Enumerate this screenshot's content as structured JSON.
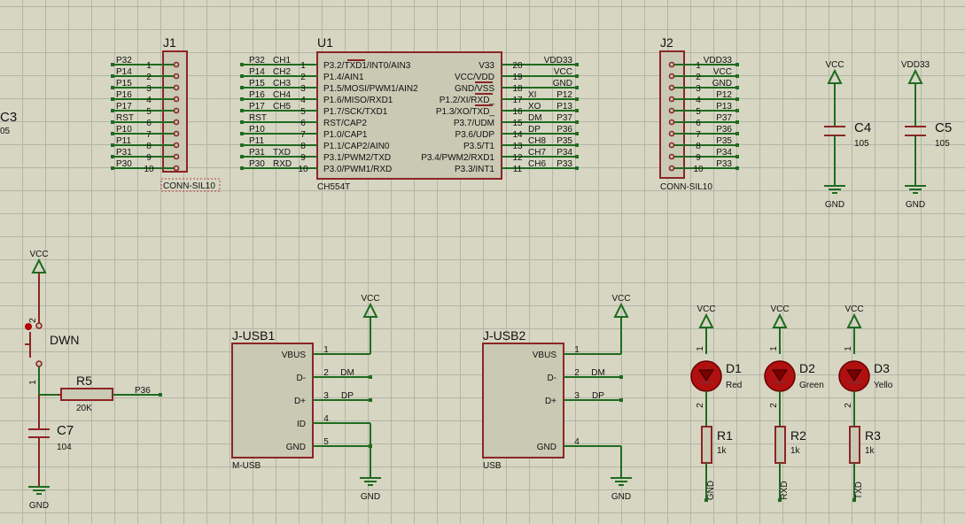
{
  "colors": {
    "background": "#d6d6c3",
    "grid": "#b5b5a6",
    "wire": "#1f6b1f",
    "component": "#8c2525",
    "body": "#c9c9b4",
    "text": "#111111"
  },
  "j1": {
    "ref": "J1",
    "type": "CONN-SIL10",
    "pins": [
      "1",
      "2",
      "3",
      "4",
      "5",
      "6",
      "7",
      "8",
      "9",
      "10"
    ],
    "nets": [
      "P32",
      "P14",
      "P15",
      "P16",
      "P17",
      "RST",
      "P10",
      "P11",
      "P31",
      "P30"
    ]
  },
  "u1": {
    "ref": "U1",
    "part": "CH554T",
    "left": [
      {
        "net": "P32",
        "ext": "CH1",
        "num": "1",
        "name": "P3.2/TXD1/INT0/AIN3"
      },
      {
        "net": "P14",
        "ext": "CH2",
        "num": "2",
        "name": "P1.4/AIN1"
      },
      {
        "net": "P15",
        "ext": "CH3",
        "num": "3",
        "name": "P1.5/MOSI/PWM1/AIN2"
      },
      {
        "net": "P16",
        "ext": "CH4",
        "num": "4",
        "name": "P1.6/MISO/RXD1"
      },
      {
        "net": "P17",
        "ext": "CH5",
        "num": "5",
        "name": "P1.7/SCK/TXD1"
      },
      {
        "net": "RST",
        "ext": "",
        "num": "6",
        "name": "RST/CAP2"
      },
      {
        "net": "P10",
        "ext": "",
        "num": "7",
        "name": "P1.0/CAP1"
      },
      {
        "net": "P11",
        "ext": "",
        "num": "8",
        "name": "P1.1/CAP2/AIN0"
      },
      {
        "net": "P31",
        "ext": "TXD",
        "num": "9",
        "name": "P3.1/PWM2/TXD"
      },
      {
        "net": "P30",
        "ext": "RXD",
        "num": "10",
        "name": "P3.0/PWM1/RXD"
      }
    ],
    "right": [
      {
        "num": "20",
        "name": "V33",
        "ext": "",
        "net": "VDD33"
      },
      {
        "num": "19",
        "name": "VCC/VDD",
        "ext": "",
        "net": "VCC"
      },
      {
        "num": "18",
        "name": "GND/VSS",
        "ext": "",
        "net": "GND"
      },
      {
        "num": "17",
        "name": "P1.2/XI/RXD_",
        "ext": "XI",
        "net": "P12"
      },
      {
        "num": "16",
        "name": "P1.3/XO/TXD_",
        "ext": "XO",
        "net": "P13"
      },
      {
        "num": "15",
        "name": "P3.7/UDM",
        "ext": "DM",
        "net": "P37"
      },
      {
        "num": "14",
        "name": "P3.6/UDP",
        "ext": "DP",
        "net": "P36"
      },
      {
        "num": "13",
        "name": "P3.5/T1",
        "ext": "CH8",
        "net": "P35"
      },
      {
        "num": "12",
        "name": "P3.4/PWM2/RXD1",
        "ext": "CH7",
        "net": "P34"
      },
      {
        "num": "11",
        "name": "P3.3/INT1",
        "ext": "CH6",
        "net": "P33"
      }
    ]
  },
  "j2": {
    "ref": "J2",
    "type": "CONN-SIL10",
    "pins": [
      "1",
      "2",
      "3",
      "4",
      "5",
      "6",
      "7",
      "8",
      "9",
      "10"
    ],
    "nets": [
      "VDD33",
      "VCC",
      "GND",
      "P12",
      "P13",
      "P37",
      "P36",
      "P35",
      "P34",
      "P33"
    ]
  },
  "c3": {
    "ref": "C3",
    "value": "05"
  },
  "c4": {
    "ref": "C4",
    "value": "105",
    "top": "VCC",
    "bottom": "GND"
  },
  "c5": {
    "ref": "C5",
    "value": "105",
    "top": "VDD33",
    "bottom": "GND"
  },
  "reset": {
    "vcc": "VCC",
    "sw_ref": "DWN",
    "pin1": "1",
    "pin2": "2",
    "r_ref": "R5",
    "r_val": "20K",
    "net": "P36",
    "c_ref": "C7",
    "c_val": "104",
    "gnd": "GND"
  },
  "usb1": {
    "ref": "J-USB1",
    "type": "M-USB",
    "vcc": "VCC",
    "gnd": "GND",
    "pins": [
      {
        "num": "1",
        "name": "VBUS",
        "net": ""
      },
      {
        "num": "2",
        "name": "D-",
        "net": "DM"
      },
      {
        "num": "3",
        "name": "D+",
        "net": "DP"
      },
      {
        "num": "4",
        "name": "ID",
        "net": ""
      },
      {
        "num": "5",
        "name": "GND",
        "net": ""
      }
    ]
  },
  "usb2": {
    "ref": "J-USB2",
    "type": "USB",
    "vcc": "VCC",
    "gnd": "GND",
    "pins": [
      {
        "num": "1",
        "name": "VBUS",
        "net": ""
      },
      {
        "num": "2",
        "name": "D-",
        "net": "DM"
      },
      {
        "num": "3",
        "name": "D+",
        "net": "DP"
      },
      {
        "num": "4",
        "name": "GND",
        "net": ""
      }
    ]
  },
  "leds": [
    {
      "vcc": "VCC",
      "ref": "D1",
      "color": "Red",
      "r_ref": "R1",
      "r_val": "1k",
      "net": "GND",
      "p1": "1",
      "p2": "2"
    },
    {
      "vcc": "VCC",
      "ref": "D2",
      "color": "Green",
      "r_ref": "R2",
      "r_val": "1k",
      "net": "RXD",
      "p1": "1",
      "p2": "2"
    },
    {
      "vcc": "VCC",
      "ref": "D3",
      "color": "Yello",
      "r_ref": "R3",
      "r_val": "1k",
      "net": "TXD",
      "p1": "1",
      "p2": "2"
    }
  ]
}
